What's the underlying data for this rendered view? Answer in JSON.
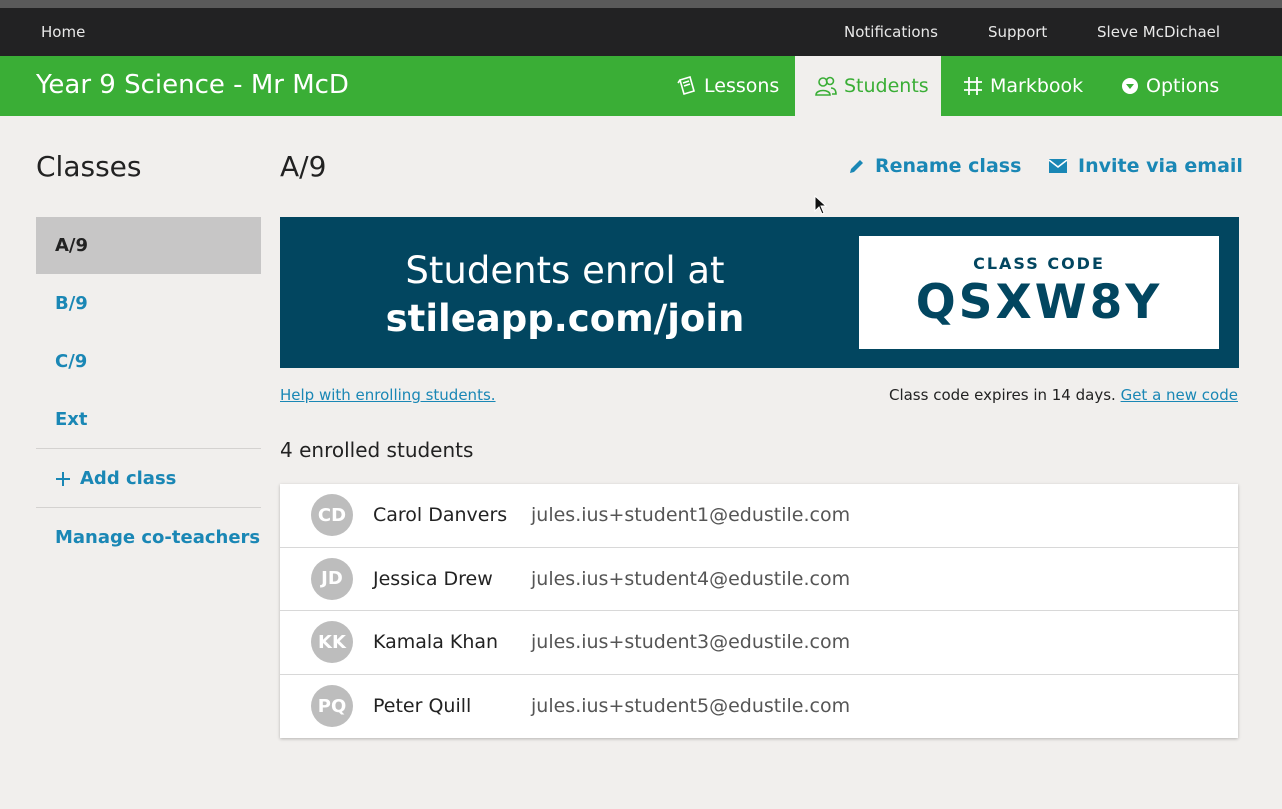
{
  "topbar": {
    "home": "Home",
    "notifications": "Notifications",
    "support": "Support",
    "user": "Sleve McDichael"
  },
  "header": {
    "title": "Year 9 Science - Mr McD",
    "tabs": {
      "lessons": "Lessons",
      "students": "Students",
      "markbook": "Markbook",
      "options": "Options"
    }
  },
  "sidebar": {
    "title": "Classes",
    "items": [
      "A/9",
      "B/9",
      "C/9",
      "Ext"
    ],
    "add_class": "Add class",
    "manage": "Manage co-teachers"
  },
  "main": {
    "title": "A/9",
    "rename": "Rename class",
    "invite": "Invite via email",
    "banner": {
      "line1": "Students enrol at",
      "line2": "stileapp.com/join",
      "code_label": "CLASS CODE",
      "code": "QSXW8Y"
    },
    "help_link": "Help with enrolling students.",
    "expiry_text": "Class code expires in 14 days.",
    "new_code_link": "Get a new code",
    "enrolled_count": "4 enrolled students",
    "students": [
      {
        "initials": "CD",
        "name": "Carol Danvers",
        "email": "jules.ius+student1@edustile.com"
      },
      {
        "initials": "JD",
        "name": "Jessica Drew",
        "email": "jules.ius+student4@edustile.com"
      },
      {
        "initials": "KK",
        "name": "Kamala Khan",
        "email": "jules.ius+student3@edustile.com"
      },
      {
        "initials": "PQ",
        "name": "Peter Quill",
        "email": "jules.ius+student5@edustile.com"
      }
    ]
  },
  "colors": {
    "brand_green": "#3aae36",
    "banner_navy": "#024660",
    "link_blue": "#1a87b5",
    "topbar_dark": "#222223"
  }
}
